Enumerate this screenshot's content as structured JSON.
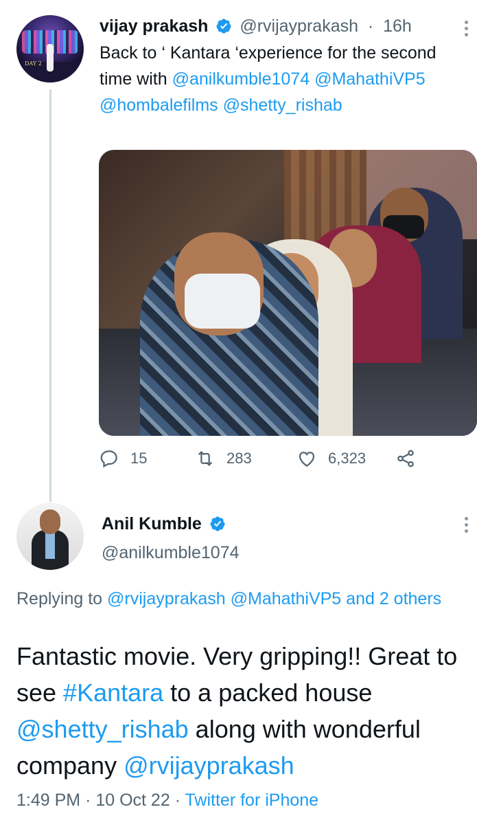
{
  "parent_tweet": {
    "name": "vijay prakash",
    "handle": "@rvijayprakash",
    "time": "16h",
    "text_prefix": "Back to ‘ Kantara ‘experience for the second time with ",
    "mentions": [
      "@anilkumble1074",
      "@MahathiVP5",
      "@hombalefilms",
      "@shetty_rishab"
    ],
    "avatar_text": "DAY 2",
    "actions": {
      "replies": "15",
      "retweets": "283",
      "likes": "6,323"
    }
  },
  "reply_tweet": {
    "name": "Anil Kumble",
    "handle": "@anilkumble1074",
    "replying_label": "Replying to ",
    "replying_mentions": [
      "@rvijayprakash",
      "@MahathiVP5"
    ],
    "replying_suffix": "and 2 others",
    "text_1": "Fantastic movie. Very gripping!! Great to see ",
    "hashtag": "#Kantara",
    "text_2": " to a packed house ",
    "mention_1": "@shetty_rishab",
    "text_3": " along with wonderful company ",
    "mention_2": "@rvijayprakash",
    "time": "1:49 PM",
    "date": "10 Oct 22",
    "source": "Twitter for iPhone"
  },
  "colors": {
    "link": "#1d9bf0",
    "muted": "#536471",
    "verified": "#1d9bf0",
    "thread_line": "#cfd9de"
  },
  "icons": [
    "verified-badge-icon",
    "more-options-icon",
    "reply-icon",
    "retweet-icon",
    "like-icon",
    "share-icon"
  ]
}
